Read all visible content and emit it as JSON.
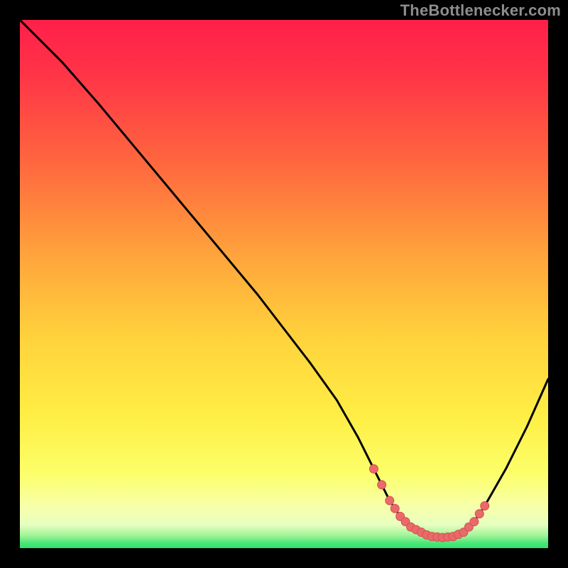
{
  "watermark": "TheBottlenecker.com",
  "colors": {
    "background": "#000000",
    "gradient_top": "#ff1f4a",
    "gradient_upper_mid": "#ff7e3c",
    "gradient_mid": "#ffd23c",
    "gradient_lower_mid": "#fff547",
    "gradient_pale": "#fbffb6",
    "gradient_bottom": "#2fe36b",
    "curve": "#000000",
    "marker_fill": "#e86a6a",
    "marker_stroke": "#d94f4f"
  },
  "plot": {
    "x_range": [
      0,
      100
    ],
    "y_range": [
      0,
      100
    ]
  },
  "chart_data": {
    "type": "line",
    "title": "",
    "xlabel": "",
    "ylabel": "",
    "xlim": [
      0,
      100
    ],
    "ylim": [
      0,
      100
    ],
    "series": [
      {
        "name": "bottleneck-curve",
        "x": [
          0,
          3,
          8,
          15,
          25,
          35,
          45,
          55,
          60,
          64,
          67,
          70,
          72,
          74,
          76,
          78,
          80,
          82,
          84,
          86,
          88,
          92,
          96,
          100
        ],
        "y": [
          100,
          97,
          92,
          84,
          72,
          60,
          48,
          35,
          28,
          21,
          15,
          9,
          6,
          4,
          3,
          2.2,
          2,
          2.2,
          3,
          5,
          8,
          15,
          23,
          32
        ]
      }
    ],
    "markers": {
      "name": "highlighted-range",
      "x": [
        67,
        68.5,
        70,
        71,
        72,
        73,
        74,
        75,
        76,
        77,
        78,
        79,
        80,
        81,
        82,
        83,
        84,
        85,
        86,
        87,
        88
      ],
      "y": [
        15,
        12,
        9,
        7.5,
        6,
        5,
        4,
        3.5,
        3,
        2.5,
        2.2,
        2.1,
        2,
        2.1,
        2.2,
        2.6,
        3,
        4,
        5,
        6.5,
        8
      ]
    }
  }
}
